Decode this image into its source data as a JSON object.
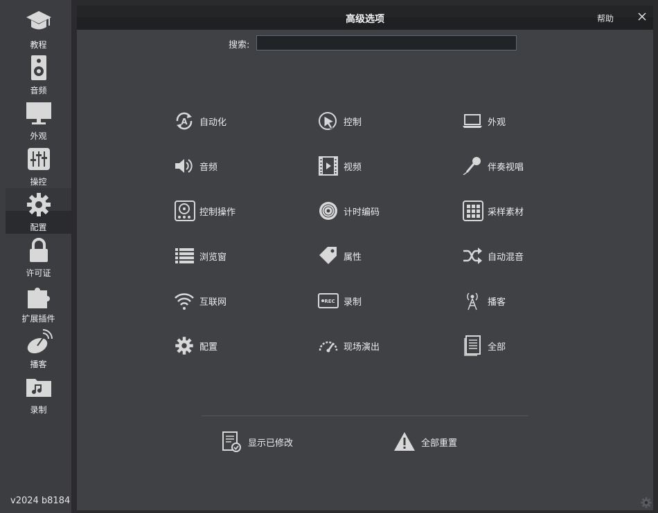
{
  "sidebar": {
    "items": [
      {
        "label": "教程",
        "icon": "graduation-cap-icon"
      },
      {
        "label": "音频",
        "icon": "speaker-icon"
      },
      {
        "label": "外观",
        "icon": "monitor-icon"
      },
      {
        "label": "操控",
        "icon": "mixer-sliders-icon"
      },
      {
        "label": "配置",
        "icon": "gear-icon"
      },
      {
        "label": "许可证",
        "icon": "lock-icon"
      },
      {
        "label": "扩展插件",
        "icon": "puzzle-icon"
      },
      {
        "label": "播客",
        "icon": "broadcast-dish-icon"
      },
      {
        "label": "录制",
        "icon": "music-folder-icon"
      }
    ],
    "active_index": 4,
    "version": "v2024 b8184"
  },
  "dialog": {
    "title": "高级选项",
    "help_label": "帮助",
    "search_label": "搜索:",
    "search_value": "",
    "options": [
      {
        "label": "自动化",
        "icon": "automation-icon"
      },
      {
        "label": "控制",
        "icon": "cursor-click-icon"
      },
      {
        "label": "外观",
        "icon": "laptop-icon"
      },
      {
        "label": "音频",
        "icon": "volume-icon"
      },
      {
        "label": "视频",
        "icon": "film-icon"
      },
      {
        "label": "伴奏视唱",
        "icon": "microphone-icon"
      },
      {
        "label": "控制操作",
        "icon": "turntable-icon"
      },
      {
        "label": "计时编码",
        "icon": "vinyl-disc-icon"
      },
      {
        "label": "采样素材",
        "icon": "sampler-pads-icon"
      },
      {
        "label": "浏览窗",
        "icon": "list-icon"
      },
      {
        "label": "属性",
        "icon": "tag-icon"
      },
      {
        "label": "自动混音",
        "icon": "shuffle-icon"
      },
      {
        "label": "互联网",
        "icon": "wifi-icon"
      },
      {
        "label": "录制",
        "icon": "rec-icon"
      },
      {
        "label": "播客",
        "icon": "antenna-icon"
      },
      {
        "label": "配置",
        "icon": "gear-icon"
      },
      {
        "label": "现场演出",
        "icon": "gauge-icon"
      },
      {
        "label": "全部",
        "icon": "document-icon"
      }
    ],
    "show_modified_label": "显示已修改",
    "reset_all_label": "全部重置"
  }
}
